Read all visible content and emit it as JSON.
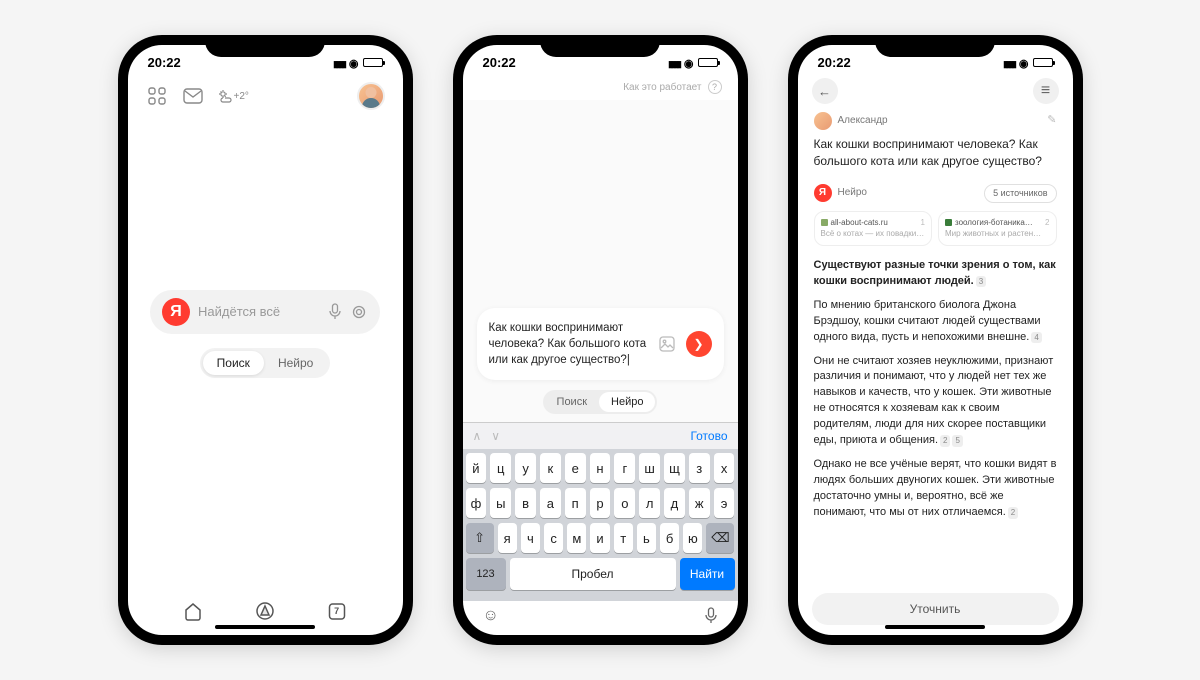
{
  "status": {
    "time": "20:22"
  },
  "phone1": {
    "weather_temp": "+2°",
    "search_placeholder": "Найдётся всё",
    "toggle": {
      "search": "Поиск",
      "neuro": "Нейро"
    },
    "calendar_day": "7"
  },
  "phone2": {
    "how_it_works": "Как это работает",
    "input_text": "Как кошки воспринимают человека? Как большого кота или как другое существо?|",
    "toggle": {
      "search": "Поиск",
      "neuro": "Нейро"
    },
    "keyboard": {
      "done": "Готово",
      "row1": [
        "й",
        "ц",
        "у",
        "к",
        "е",
        "н",
        "г",
        "ш",
        "щ",
        "з",
        "х"
      ],
      "row2": [
        "ф",
        "ы",
        "в",
        "а",
        "п",
        "р",
        "о",
        "л",
        "д",
        "ж",
        "э"
      ],
      "row3": [
        "я",
        "ч",
        "с",
        "м",
        "и",
        "т",
        "ь",
        "б",
        "ю"
      ],
      "num": "123",
      "space": "Пробел",
      "go": "Найти"
    }
  },
  "phone3": {
    "user_name": "Александр",
    "user_question": "Как кошки воспринимают человека? Как большого кота или как другое существо?",
    "neuro_label": "Нейро",
    "sources_count_label": "5 источников",
    "sources": [
      {
        "host": "all-about-cats.ru",
        "n": "1",
        "sub": "Всё о котах — их повадки…"
      },
      {
        "host": "зоология-ботаника…",
        "n": "2",
        "sub": "Мир животных и растен…"
      }
    ],
    "answer": {
      "lead": "Существуют разные точки зрения о том, как кошки воспринимают людей.",
      "lead_cite": "3",
      "p1": "По мнению британского биолога Джона Брэдшоу, кошки считают людей существами одного вида, пусть и непохожими внешне.",
      "p1_cite": "4",
      "p2": "Они не считают хозяев неуклюжими, признают различия и понимают, что у людей нет тех же навыков и качеств, что у кошек. Эти животные не относятся к хозяевам как к своим родителям, люди для них скорее поставщики еды, приюта и общения.",
      "p2_c1": "2",
      "p2_c2": "5",
      "p3": "Однако не все учёные верят, что кошки видят в людях больших двуногих кошек. Эти животные достаточно умны и, вероятно, всё же понимают, что мы от них отличаемся.",
      "p3_cite": "2"
    },
    "refine_label": "Уточнить"
  }
}
